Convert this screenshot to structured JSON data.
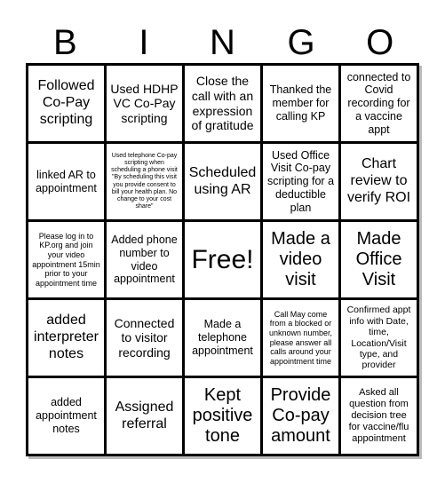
{
  "header": {
    "letters": [
      "B",
      "I",
      "N",
      "G",
      "O"
    ]
  },
  "cells": [
    [
      "Followed Co-Pay scripting",
      "Used HDHP VC Co-Pay scripting",
      "Close the call with an expression of gratitude",
      "Thanked the member for calling KP",
      "connected to Covid recording for a vaccine appt"
    ],
    [
      "linked AR to appointment",
      "Used telephone Co-pay scripting when scheduling a phone visit \"By scheduling this visit you provide consent to bill your health plan. No change to your cost share\"",
      "Scheduled using AR",
      "Used Office Visit Co-pay scripting for a deductible plan",
      "Chart review to verify ROI"
    ],
    [
      "Please log in to KP.org and join your video appointment 15min prior to your appointment time",
      "Added phone number to video appointment",
      "Free!",
      "Made a video visit",
      "Made Office Visit"
    ],
    [
      "added interpreter notes",
      "Connected to visitor recording",
      "Made a telephone appointment",
      "Call May come from a blocked or unknown number, please answer all calls around your appointment time",
      "Confirmed appt info with Date, time, Location/Visit type, and provider"
    ],
    [
      "added appointment notes",
      "Assigned referral",
      "Kept positive tone",
      "Provide Co-pay amount",
      "Asked all question from decision tree for vaccine/flu appointment"
    ]
  ]
}
